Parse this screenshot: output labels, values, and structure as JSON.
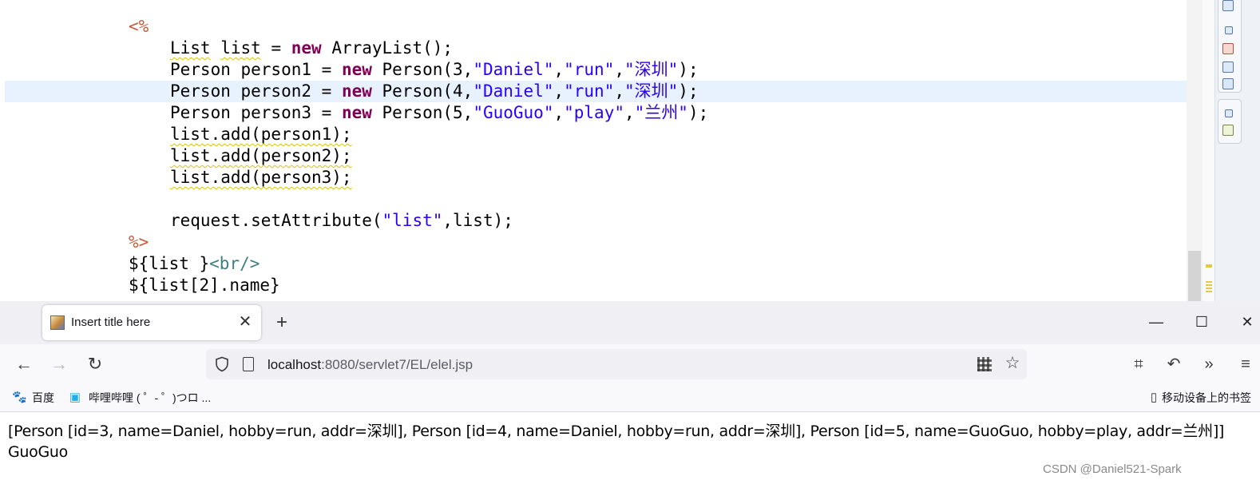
{
  "editor": {
    "lines": [
      {
        "id": "l1",
        "segments": [
          {
            "t": "<%",
            "c": "jsp"
          }
        ]
      },
      {
        "id": "l2",
        "segments": [
          {
            "t": "List",
            "c": "wavy"
          },
          {
            "t": " "
          },
          {
            "t": "list",
            "c": "wavy"
          },
          {
            "t": " = "
          },
          {
            "t": "new",
            "c": "kw"
          },
          {
            "t": " ArrayList();"
          }
        ]
      },
      {
        "id": "l3",
        "segments": [
          {
            "t": "Person person1 = "
          },
          {
            "t": "new",
            "c": "kw"
          },
          {
            "t": " Person(3,"
          },
          {
            "t": "\"Daniel\"",
            "c": "str"
          },
          {
            "t": ","
          },
          {
            "t": "\"run\"",
            "c": "str"
          },
          {
            "t": ","
          },
          {
            "t": "\"深圳\"",
            "c": "str"
          },
          {
            "t": ");"
          }
        ]
      },
      {
        "id": "l4",
        "segments": [
          {
            "t": "Person person2 = "
          },
          {
            "t": "new",
            "c": "kw"
          },
          {
            "t": " Person(4,"
          },
          {
            "t": "\"Daniel\"",
            "c": "str"
          },
          {
            "t": ","
          },
          {
            "t": "\"run\"",
            "c": "str"
          },
          {
            "t": ","
          },
          {
            "t": "\"深圳\"",
            "c": "str"
          },
          {
            "t": ");"
          }
        ]
      },
      {
        "id": "l5",
        "segments": [
          {
            "t": "Person person3 = "
          },
          {
            "t": "new",
            "c": "kw"
          },
          {
            "t": " Person(5,"
          },
          {
            "t": "\"GuoGuo\"",
            "c": "str"
          },
          {
            "t": ","
          },
          {
            "t": "\"play\"",
            "c": "str"
          },
          {
            "t": ","
          },
          {
            "t": "\"兰州\"",
            "c": "str"
          },
          {
            "t": ");"
          }
        ]
      },
      {
        "id": "l6",
        "segments": [
          {
            "t": "list.add(person1);",
            "c": "wavy"
          }
        ]
      },
      {
        "id": "l7",
        "segments": [
          {
            "t": "list.add(person2);",
            "c": "wavy"
          }
        ]
      },
      {
        "id": "l8",
        "segments": [
          {
            "t": "list.add(person3);",
            "c": "wavy"
          }
        ]
      },
      {
        "id": "l9",
        "segments": []
      },
      {
        "id": "l10",
        "segments": [
          {
            "t": "request.setAttribute("
          },
          {
            "t": "\"list\"",
            "c": "str"
          },
          {
            "t": ",list);"
          }
        ]
      },
      {
        "id": "l11",
        "segments": [
          {
            "t": "%>",
            "c": "jsp"
          }
        ]
      },
      {
        "id": "l12",
        "segments": [
          {
            "t": "${list }"
          },
          {
            "t": "<br/>",
            "c": "tag"
          }
        ]
      },
      {
        "id": "l13",
        "segments": [
          {
            "t": "${list[2].name}"
          }
        ]
      }
    ]
  },
  "browser": {
    "tab": {
      "title": "Insert title here",
      "close_label": "✕",
      "new_tab_label": "+"
    },
    "window": {
      "minimize": "—",
      "maximize": "☐",
      "close": "✕"
    },
    "nav": {
      "back": "←",
      "forward": "→",
      "reload": "↻"
    },
    "url": {
      "host": "localhost",
      "rest": ":8080/servlet7/EL/elel.jsp"
    },
    "toolbar": {
      "crop": "⌗",
      "undo": "↶",
      "more": "»",
      "menu": "≡"
    },
    "bookmarks": [
      {
        "icon": "🐾",
        "label": "百度"
      },
      {
        "icon": "▣",
        "label": "哔哩哔哩 ( ゜- ゜)つロ ..."
      }
    ],
    "mobile_bookmarks": {
      "icon": "▯",
      "label": "移动设备上的书签"
    },
    "page": {
      "line1": "[Person [id=3, name=Daniel, hobby=run, addr=深圳], Person [id=4, name=Daniel, hobby=run, addr=深圳], Person [id=5, name=GuoGuo, hobby=play, addr=兰州]]",
      "line2": "GuoGuo"
    }
  },
  "watermark": "CSDN @Daniel521-Spark"
}
